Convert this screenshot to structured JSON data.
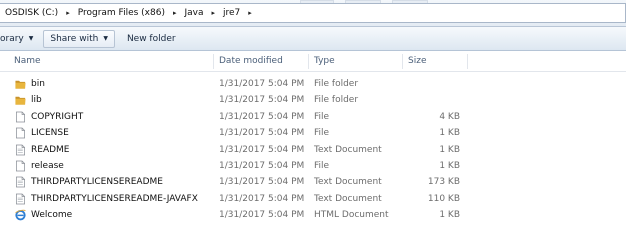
{
  "address": {
    "crumbs": [
      "OSDISK (C:)",
      "Program Files (x86)",
      "Java",
      "jre7"
    ],
    "separator": "▸"
  },
  "toolbar": {
    "library_label": "orary",
    "share_label": "Share with",
    "new_folder_label": "New folder"
  },
  "columns": {
    "name": "Name",
    "date": "Date modified",
    "type": "Type",
    "size": "Size"
  },
  "files": [
    {
      "name": "bin",
      "date": "1/31/2017 5:04 PM",
      "type": "File folder",
      "size": "",
      "icon": "folder-icon"
    },
    {
      "name": "lib",
      "date": "1/31/2017 5:04 PM",
      "type": "File folder",
      "size": "",
      "icon": "folder-icon"
    },
    {
      "name": "COPYRIGHT",
      "date": "1/31/2017 5:04 PM",
      "type": "File",
      "size": "4 KB",
      "icon": "file-icon"
    },
    {
      "name": "LICENSE",
      "date": "1/31/2017 5:04 PM",
      "type": "File",
      "size": "1 KB",
      "icon": "file-icon"
    },
    {
      "name": "README",
      "date": "1/31/2017 5:04 PM",
      "type": "Text Document",
      "size": "1 KB",
      "icon": "text-document-icon"
    },
    {
      "name": "release",
      "date": "1/31/2017 5:04 PM",
      "type": "File",
      "size": "1 KB",
      "icon": "file-icon"
    },
    {
      "name": "THIRDPARTYLICENSEREADME",
      "date": "1/31/2017 5:04 PM",
      "type": "Text Document",
      "size": "173 KB",
      "icon": "text-document-icon"
    },
    {
      "name": "THIRDPARTYLICENSEREADME-JAVAFX",
      "date": "1/31/2017 5:04 PM",
      "type": "Text Document",
      "size": "110 KB",
      "icon": "text-document-icon"
    },
    {
      "name": "Welcome",
      "date": "1/31/2017 5:04 PM",
      "type": "HTML Document",
      "size": "1 KB",
      "icon": "html-document-icon"
    }
  ],
  "colors": {
    "folder": "#e8b53d",
    "folder_dark": "#c8922a",
    "ie_blue": "#2f7fd3",
    "header_text": "#4c607a",
    "detail_text": "#6d6d6d"
  }
}
